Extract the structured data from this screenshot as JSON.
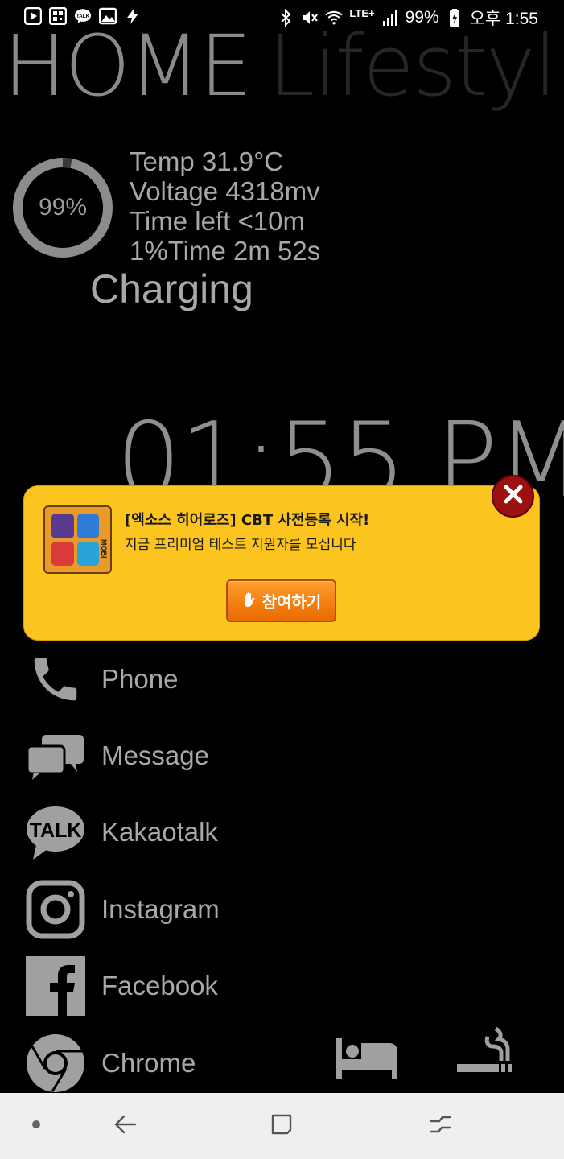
{
  "status_bar": {
    "battery": "99%",
    "time": "오후 1:55",
    "network": "LTE+",
    "left_icons": [
      "youtube-icon",
      "qr-icon",
      "kakaotalk-icon",
      "gallery-icon",
      "flash-icon"
    ],
    "right_icons": [
      "bluetooth-icon",
      "mute-icon",
      "wifi-icon",
      "signal-icon",
      "battery-charging-icon"
    ]
  },
  "header": {
    "home": "HOME",
    "lifestyle": "Lifestyl"
  },
  "battery_widget": {
    "percent_value": 99,
    "percent_label": "99%",
    "temp": "Temp 31.9°C",
    "voltage": "Voltage 4318mv",
    "time_left": "Time left <10m",
    "per_percent": "1%Time 2m 52s",
    "status": "Charging"
  },
  "clock": {
    "time": "01:55 PM"
  },
  "ad": {
    "title": "[엑소스 히어로즈] CBT 사전등록 시작!",
    "subtitle": "지금 프리미엄 테스트 지원자를 모십니다",
    "button_label": "참여하기",
    "logo_text": "MOBI",
    "colors": {
      "background": "#fcc41f",
      "button": "#f07a0a",
      "close": "#9b1010"
    }
  },
  "apps": [
    {
      "label": "Phone",
      "icon": "phone-icon"
    },
    {
      "label": "Message",
      "icon": "message-icon"
    },
    {
      "label": "Kakaotalk",
      "icon": "kakaotalk-icon"
    },
    {
      "label": "Instagram",
      "icon": "instagram-icon"
    },
    {
      "label": "Facebook",
      "icon": "facebook-icon"
    },
    {
      "label": "Chrome",
      "icon": "chrome-icon"
    }
  ],
  "shortcuts": [
    "bed-icon",
    "smoking-icon"
  ],
  "nav_bar": [
    "dot-icon",
    "back-icon",
    "home-icon",
    "recents-icon"
  ]
}
